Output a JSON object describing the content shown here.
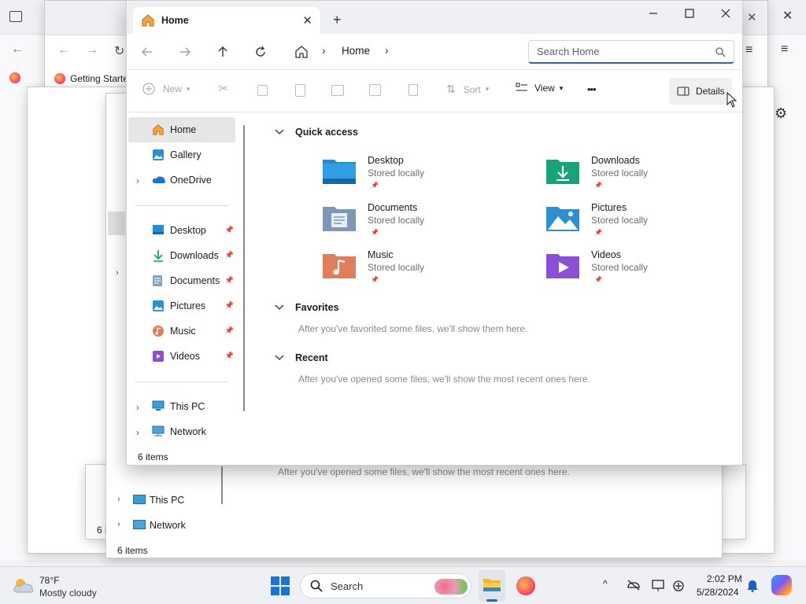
{
  "background_windows": {
    "firefox_bookmark": "Getting Starte",
    "items_count": "6 items",
    "sidebar_partial": "6 i",
    "recent_msg": "After you've opened some files, we'll show the most recent ones here.",
    "this_pc": "This PC",
    "network": "Network"
  },
  "window": {
    "tab_title": "Home",
    "breadcrumb": [
      "Home"
    ],
    "search_placeholder": "Search Home"
  },
  "commands": {
    "new": "New",
    "sort": "Sort",
    "view": "View",
    "more": "•••",
    "details": "Details"
  },
  "sidebar": {
    "top_items": [
      {
        "label": "Home",
        "icon": "home-icon",
        "selected": true
      },
      {
        "label": "Gallery",
        "icon": "gallery-icon"
      },
      {
        "label": "OneDrive",
        "icon": "onedrive-icon",
        "expandable": true
      }
    ],
    "pinned": [
      {
        "label": "Desktop",
        "icon": "desktop-folder-icon"
      },
      {
        "label": "Downloads",
        "icon": "downloads-icon"
      },
      {
        "label": "Documents",
        "icon": "documents-icon"
      },
      {
        "label": "Pictures",
        "icon": "pictures-icon"
      },
      {
        "label": "Music",
        "icon": "music-icon"
      },
      {
        "label": "Videos",
        "icon": "videos-icon"
      }
    ],
    "bottom_items": [
      {
        "label": "This PC",
        "icon": "this-pc-icon"
      },
      {
        "label": "Network",
        "icon": "network-icon"
      }
    ]
  },
  "status_bar": "6 items",
  "content": {
    "quick_access": {
      "title": "Quick access",
      "items": [
        {
          "name": "Desktop",
          "sub": "Stored locally",
          "icon": "desktop-folder-icon"
        },
        {
          "name": "Downloads",
          "sub": "Stored locally",
          "icon": "downloads-folder-icon"
        },
        {
          "name": "Documents",
          "sub": "Stored locally",
          "icon": "documents-folder-icon"
        },
        {
          "name": "Pictures",
          "sub": "Stored locally",
          "icon": "pictures-folder-icon"
        },
        {
          "name": "Music",
          "sub": "Stored locally",
          "icon": "music-folder-icon"
        },
        {
          "name": "Videos",
          "sub": "Stored locally",
          "icon": "videos-folder-icon"
        }
      ]
    },
    "favorites": {
      "title": "Favorites",
      "empty": "After you've favorited some files, we'll show them here."
    },
    "recent": {
      "title": "Recent",
      "empty": "After you've opened some files, we'll show the most recent ones here."
    }
  },
  "taskbar": {
    "weather_temp": "78°F",
    "weather_desc": "Mostly cloudy",
    "search_label": "Search",
    "time": "2:02 PM",
    "date": "5/28/2024"
  },
  "colors": {
    "accent": "#2b62c4",
    "folder_desktop": "#1e8ed6",
    "folder_downloads": "#17a47a",
    "folder_documents": "#7c98b6",
    "folder_pictures": "#2b8fd6",
    "folder_music": "#e27d5c",
    "folder_videos": "#8a4fd4"
  }
}
